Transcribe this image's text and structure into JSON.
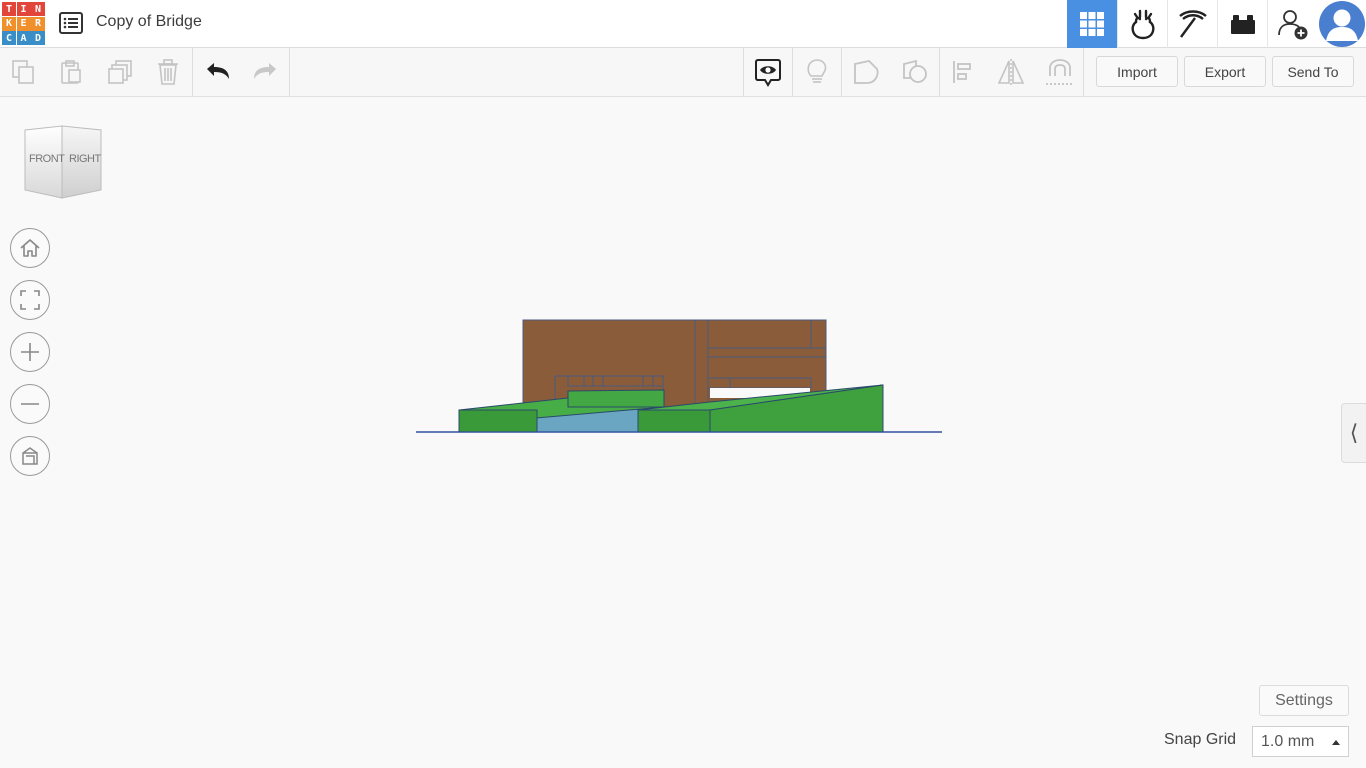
{
  "app": {
    "logo_letters": [
      "T",
      "I",
      "N",
      "K",
      "E",
      "R",
      "C",
      "A",
      "D"
    ],
    "logo_colors": [
      "#e2463b",
      "#e2463b",
      "#e2463b",
      "#f0902c",
      "#f0902c",
      "#f0902c",
      "#4aa6d8",
      "#4aa6d8",
      "#4aa6d8"
    ],
    "design_title": "Copy of Bridge"
  },
  "header": {
    "icons": [
      "3d-design-grid-icon",
      "circuits-icon",
      "minecraft-pickaxe-icon",
      "lego-brick-icon",
      "invite-user-icon",
      "avatar"
    ],
    "accent_color": "#4a90e2"
  },
  "toolbar": {
    "edit_icons": [
      "copy-icon",
      "paste-icon",
      "duplicate-icon",
      "delete-icon",
      "undo-icon",
      "redo-icon"
    ],
    "shape_icons": [
      "show-notes-icon",
      "show-all-icon",
      "solid-icon",
      "hole-icon",
      "align-icon",
      "mirror-icon",
      "cruise-icon"
    ],
    "import_label": "Import",
    "export_label": "Export",
    "send_to_label": "Send To"
  },
  "viewcube": {
    "front_label": "FRONT",
    "right_label": "RIGHT"
  },
  "view_controls": [
    "home-view-icon",
    "fit-view-icon",
    "zoom-in-icon",
    "zoom-out-icon",
    "perspective-icon"
  ],
  "scene": {
    "colors": {
      "bridge_brown": "#8a5c3a",
      "ramp_green": "#3a9a3a",
      "ramp_green_dark": "#2f8a2f",
      "water_blue": "#6aa6c2",
      "workplane_line": "#2a4a9a"
    }
  },
  "footer": {
    "settings_label": "Settings",
    "snap_grid_label": "Snap Grid",
    "snap_grid_value": "1.0 mm"
  }
}
